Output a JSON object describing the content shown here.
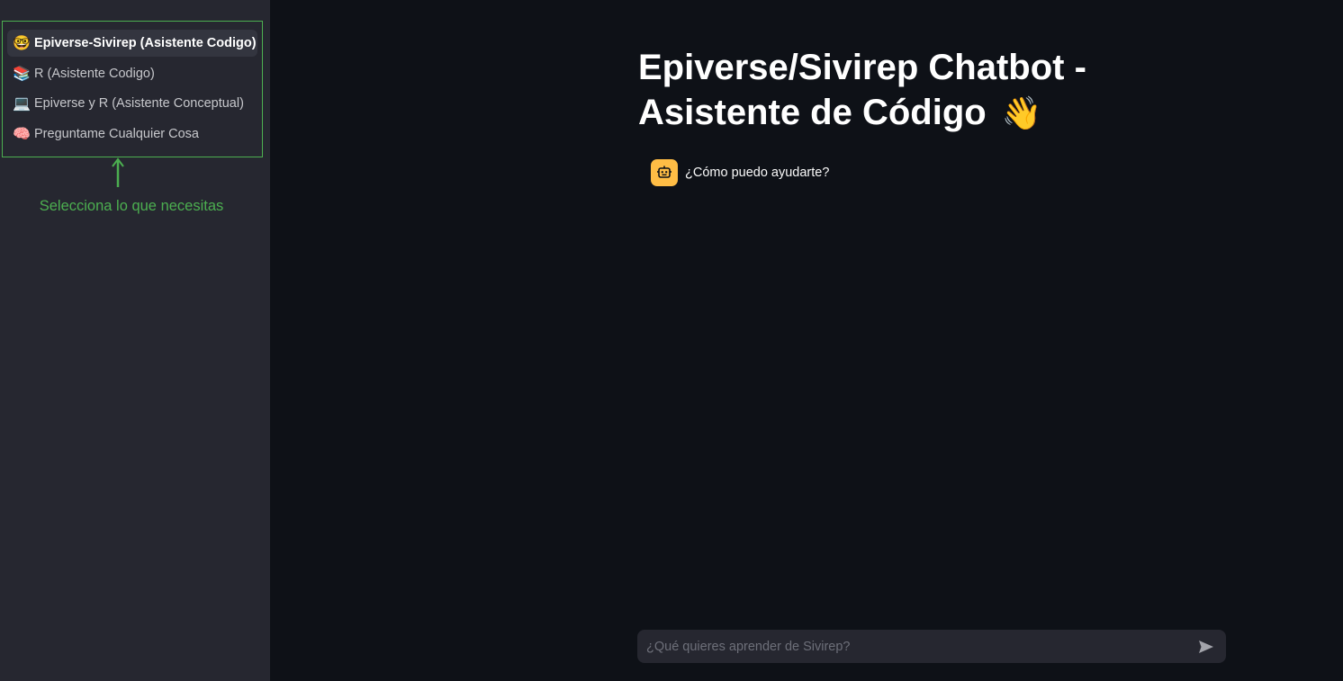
{
  "sidebar": {
    "items": [
      {
        "icon": "nerd-face-icon",
        "emoji": "🤓",
        "label": "Epiverse-Sivirep (Asistente Codigo)",
        "active": true
      },
      {
        "icon": "books-icon",
        "emoji": "📚",
        "label": "R (Asistente Codigo)",
        "active": false
      },
      {
        "icon": "laptop-icon",
        "emoji": "💻",
        "label": "Epiverse y R (Asistente Conceptual)",
        "active": false
      },
      {
        "icon": "brain-icon",
        "emoji": "🧠",
        "label": "Preguntame Cualquier Cosa",
        "active": false
      }
    ],
    "hint": "Selecciona lo que necesitas",
    "annotation_color": "#4caf50"
  },
  "main": {
    "title": "Epiverse/Sivirep Chatbot - Asistente de Código",
    "title_emoji": "👋",
    "messages": [
      {
        "role": "assistant",
        "avatar_icon": "robot-icon",
        "text": "¿Cómo puedo ayudarte?"
      }
    ],
    "chat_input": {
      "placeholder": "¿Qué quieres aprender de Sivirep?",
      "value": ""
    }
  },
  "colors": {
    "background": "#0e1117",
    "sidebar": "#262730",
    "avatar": "#ffbd45"
  }
}
